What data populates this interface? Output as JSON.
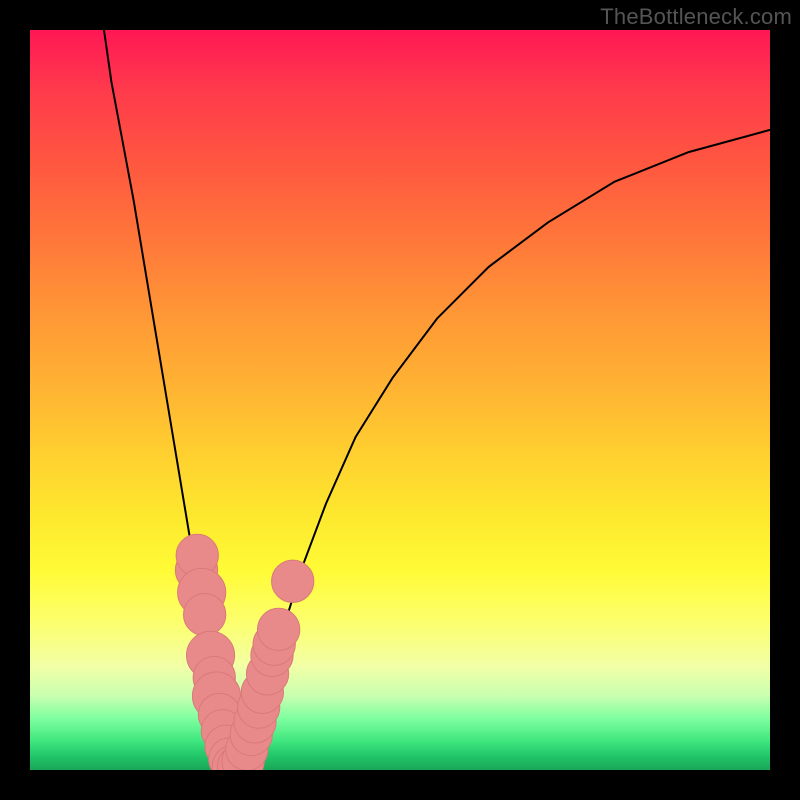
{
  "watermark": "TheBottleneck.com",
  "colors": {
    "curve": "#000000",
    "marker_fill": "#e98a8a",
    "marker_stroke": "#d97979",
    "gradient_top": "#ff1754",
    "gradient_bottom": "#1aa658"
  },
  "chart_data": {
    "type": "line",
    "title": "",
    "xlabel": "",
    "ylabel": "",
    "xlim": [
      0,
      100
    ],
    "ylim": [
      0,
      100
    ],
    "grid": false,
    "legend": false,
    "series": [
      {
        "name": "left-branch",
        "x": [
          10,
          11,
          12.5,
          14,
          15.5,
          17,
          18.5,
          20,
          21.5,
          22.8,
          24,
          25,
          25.8,
          26.4,
          26.9,
          27.3
        ],
        "y": [
          100,
          93,
          85,
          77,
          68,
          59,
          50,
          41,
          32,
          24,
          17,
          11,
          6.5,
          3.5,
          1.5,
          0.3
        ]
      },
      {
        "name": "right-branch",
        "x": [
          28.4,
          29,
          29.8,
          31,
          32.5,
          34.5,
          37,
          40,
          44,
          49,
          55,
          62,
          70,
          79,
          89,
          100
        ],
        "y": [
          0.3,
          1.5,
          4,
          8,
          13,
          20,
          28,
          36,
          45,
          53,
          61,
          68,
          74,
          79.5,
          83.5,
          86.5
        ]
      }
    ],
    "scatter": {
      "name": "data-points",
      "points": [
        {
          "x": 22.5,
          "y": 27,
          "r": 2.2
        },
        {
          "x": 22.6,
          "y": 29,
          "r": 2.2
        },
        {
          "x": 23.2,
          "y": 24,
          "r": 2.5
        },
        {
          "x": 23.6,
          "y": 21,
          "r": 2.2
        },
        {
          "x": 24.4,
          "y": 15.5,
          "r": 2.5
        },
        {
          "x": 24.9,
          "y": 12.5,
          "r": 2.2
        },
        {
          "x": 25.2,
          "y": 10,
          "r": 2.5
        },
        {
          "x": 25.6,
          "y": 7.5,
          "r": 2.2
        },
        {
          "x": 26.0,
          "y": 5.3,
          "r": 2.2
        },
        {
          "x": 26.5,
          "y": 3.2,
          "r": 2.2
        },
        {
          "x": 27.0,
          "y": 1.5,
          "r": 2.2
        },
        {
          "x": 27.5,
          "y": 0.5,
          "r": 2.2
        },
        {
          "x": 28.2,
          "y": 0.5,
          "r": 2.2
        },
        {
          "x": 28.8,
          "y": 1.2,
          "r": 2.2
        },
        {
          "x": 29.3,
          "y": 2.8,
          "r": 2.2
        },
        {
          "x": 29.9,
          "y": 4.8,
          "r": 2.2
        },
        {
          "x": 30.4,
          "y": 6.5,
          "r": 2.2
        },
        {
          "x": 30.9,
          "y": 8.5,
          "r": 2.2
        },
        {
          "x": 31.4,
          "y": 10.5,
          "r": 2.2
        },
        {
          "x": 32.1,
          "y": 13,
          "r": 2.2
        },
        {
          "x": 32.7,
          "y": 15.5,
          "r": 2.2
        },
        {
          "x": 33.0,
          "y": 17,
          "r": 2.2
        },
        {
          "x": 33.6,
          "y": 19,
          "r": 2.2
        },
        {
          "x": 35.5,
          "y": 25.5,
          "r": 2.2
        }
      ]
    }
  }
}
